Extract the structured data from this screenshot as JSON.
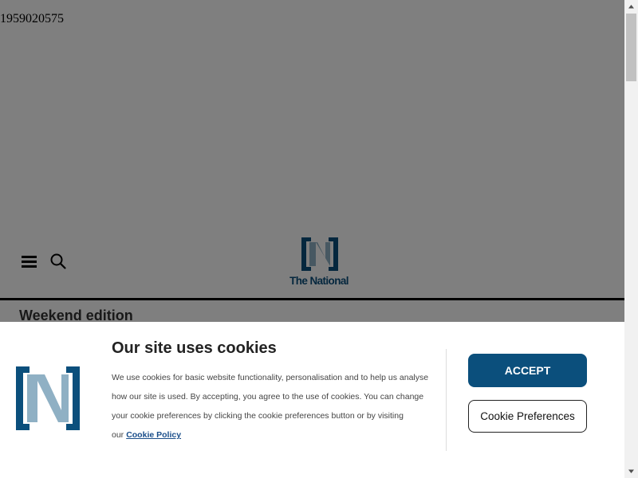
{
  "ad": {
    "id_text": "1959020575"
  },
  "header": {
    "logo_text": "The National",
    "edition_label": "Weekend edition"
  },
  "cookie_banner": {
    "title": "Our site uses cookies",
    "body": "We use cookies for basic website functionality, personalisation and to help us analyse how our site is used. By accepting, you agree to the use of cookies. You can change your cookie preferences by clicking the cookie preferences button or by visiting our",
    "policy_link": "Cookie Policy",
    "accept_label": "ACCEPT",
    "preferences_label": "Cookie Preferences"
  },
  "colors": {
    "brand_dark": "#0b4f7c",
    "brand_light": "#8fb0c4",
    "overlay": "rgba(0,0,0,0.5)"
  },
  "icons": {
    "menu": "hamburger-icon",
    "search": "search-icon",
    "scroll_up": "arrow-up-icon",
    "scroll_down": "arrow-down-icon"
  }
}
